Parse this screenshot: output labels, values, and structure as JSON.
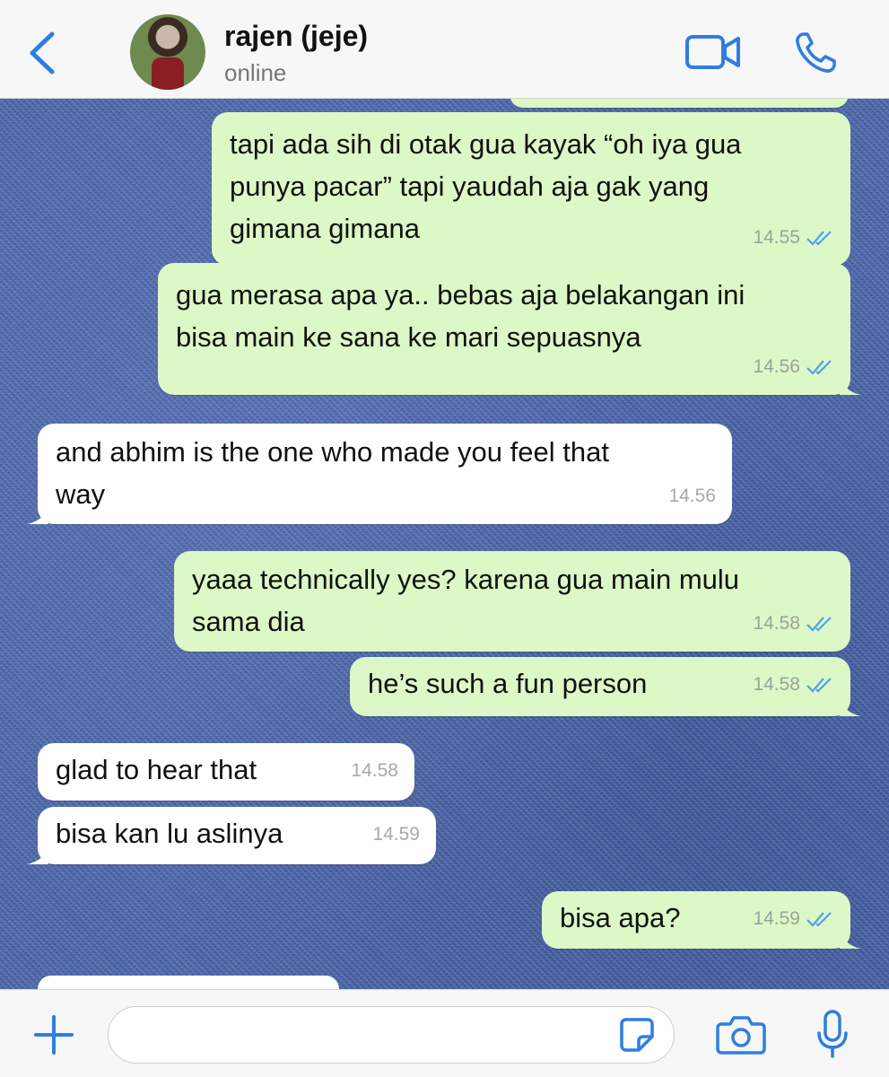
{
  "header": {
    "contact_name": "rajen (jeje)",
    "status": "online"
  },
  "messages": [
    {
      "text": "tapi ada sih di otak gua kayak “oh iya gua\npunya pacar” tapi yaudah aja gak yang\ngimana gimana",
      "time": "14.55",
      "direction": "out",
      "read": true
    },
    {
      "text": "gua merasa apa ya.. bebas aja belakangan ini\nbisa main ke sana ke mari sepuasnya",
      "time": "14.56",
      "direction": "out",
      "read": true
    },
    {
      "text": "and abhim is the one who made you feel that\nway",
      "time": "14.56",
      "direction": "in"
    },
    {
      "text": "yaaa technically yes? karena gua main mulu\nsama dia",
      "time": "14.58",
      "direction": "out",
      "read": true
    },
    {
      "text": "he’s such a fun person",
      "time": "14.58",
      "direction": "out",
      "read": true
    },
    {
      "text": "glad to hear that",
      "time": "14.58",
      "direction": "in"
    },
    {
      "text": "bisa kan lu aslinya",
      "time": "14.59",
      "direction": "in"
    },
    {
      "text": "bisa apa?",
      "time": "14.59",
      "direction": "out",
      "read": true
    }
  ],
  "input": {
    "placeholder": "",
    "value": ""
  },
  "colors": {
    "accent": "#2f7de1",
    "outgoing_bubble": "#dcf8c6",
    "incoming_bubble": "#ffffff",
    "read_ticks": "#4fa3e8"
  },
  "icons": [
    "back-icon",
    "video-call-icon",
    "phone-icon",
    "plus-icon",
    "sticker-icon",
    "camera-icon",
    "mic-icon"
  ]
}
